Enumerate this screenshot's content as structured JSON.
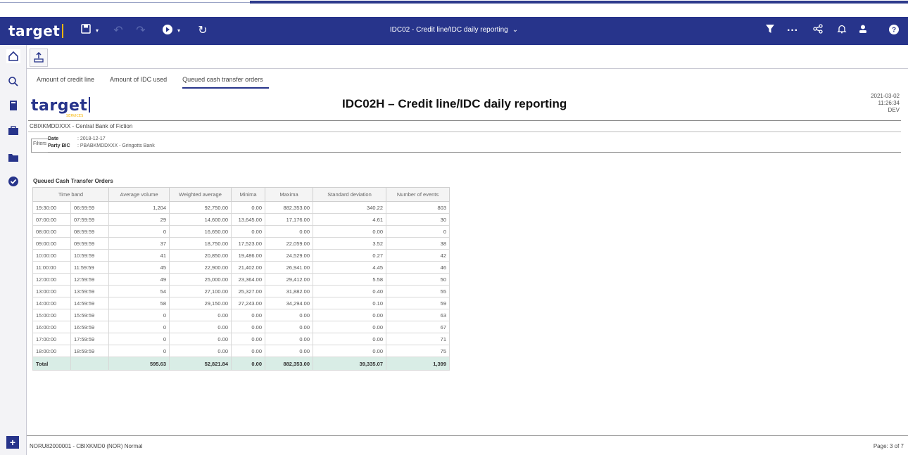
{
  "app": {
    "logo": "target",
    "title": "IDC02 - Credit line/IDC daily reporting"
  },
  "tabs": [
    {
      "label": "Amount of credit line",
      "active": false
    },
    {
      "label": "Amount of IDC used",
      "active": false
    },
    {
      "label": "Queued cash transfer orders",
      "active": true
    }
  ],
  "report": {
    "logo": "target",
    "logo_sub": "SERVICES",
    "title": "IDC02H – Credit line/IDC daily reporting",
    "date": "2021-03-02",
    "time": "11:26:34",
    "env": "DEV",
    "bank": "CBIXKMDDXXX - Central Bank of Fiction",
    "filters_label": "Filters",
    "filters": [
      {
        "key": "Date",
        "value": ": 2018-12-17"
      },
      {
        "key": "Party BIC",
        "value": ": PBABKMDDXXX - Gringotts Bank"
      }
    ],
    "section_title": "Queued Cash Transfer Orders",
    "columns": [
      "Time band",
      "Average volume",
      "Weighted average",
      "Minima",
      "Maxima",
      "Standard deviation",
      "Number of events"
    ],
    "rows": [
      [
        "19:30:00",
        "06:59:59",
        "1,204",
        "92,750.00",
        "0.00",
        "882,353.00",
        "340.22",
        "803"
      ],
      [
        "07:00:00",
        "07:59:59",
        "29",
        "14,600.00",
        "13,645.00",
        "17,176.00",
        "4.61",
        "30"
      ],
      [
        "08:00:00",
        "08:59:59",
        "0",
        "16,650.00",
        "0.00",
        "0.00",
        "0.00",
        "0"
      ],
      [
        "09:00:00",
        "09:59:59",
        "37",
        "18,750.00",
        "17,523.00",
        "22,059.00",
        "3.52",
        "38"
      ],
      [
        "10:00:00",
        "10:59:59",
        "41",
        "20,850.00",
        "19,486.00",
        "24,529.00",
        "0.27",
        "42"
      ],
      [
        "11:00:00",
        "11:59:59",
        "45",
        "22,900.00",
        "21,402.00",
        "26,941.00",
        "4.45",
        "46"
      ],
      [
        "12:00:00",
        "12:59:59",
        "49",
        "25,000.00",
        "23,364.00",
        "29,412.00",
        "5.58",
        "50"
      ],
      [
        "13:00:00",
        "13:59:59",
        "54",
        "27,100.00",
        "25,327.00",
        "31,882.00",
        "0.40",
        "55"
      ],
      [
        "14:00:00",
        "14:59:59",
        "58",
        "29,150.00",
        "27,243.00",
        "34,294.00",
        "0.10",
        "59"
      ],
      [
        "15:00:00",
        "15:59:59",
        "0",
        "0.00",
        "0.00",
        "0.00",
        "0.00",
        "63"
      ],
      [
        "16:00:00",
        "16:59:59",
        "0",
        "0.00",
        "0.00",
        "0.00",
        "0.00",
        "67"
      ],
      [
        "17:00:00",
        "17:59:59",
        "0",
        "0.00",
        "0.00",
        "0.00",
        "0.00",
        "71"
      ],
      [
        "18:00:00",
        "18:59:59",
        "0",
        "0.00",
        "0.00",
        "0.00",
        "0.00",
        "75"
      ]
    ],
    "total": [
      "Total",
      "",
      "595.63",
      "52,821.84",
      "0.00",
      "882,353.00",
      "39,335.07",
      "1,399"
    ]
  },
  "footer": {
    "left": "NORU82000001 - CBIXKMD0 (NOR) Normal",
    "right": "Page: 3 of 7"
  },
  "colors": {
    "brand": "#27348b",
    "accent": "#f7b500",
    "total_row": "#d9ede6"
  }
}
